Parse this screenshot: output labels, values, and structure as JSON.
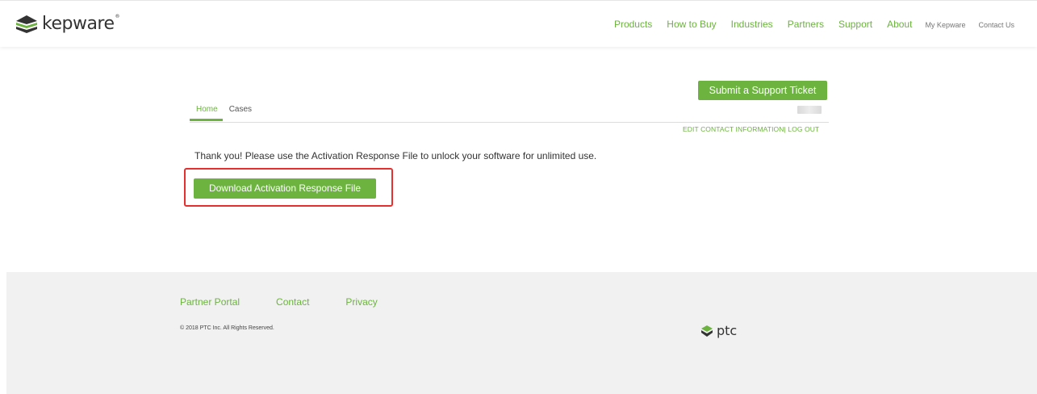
{
  "header": {
    "logo_text": "kepware",
    "logo_reg": "®",
    "nav": [
      {
        "label": "Products"
      },
      {
        "label": "How to Buy"
      },
      {
        "label": "Industries"
      },
      {
        "label": "Partners"
      },
      {
        "label": "Support"
      },
      {
        "label": "About"
      }
    ],
    "nav_small": [
      {
        "label": "My Kepware"
      },
      {
        "label": "Contact Us"
      }
    ]
  },
  "support": {
    "submit_label": "Submit a Support Ticket",
    "tabs": [
      {
        "label": "Home",
        "active": true
      },
      {
        "label": "Cases",
        "active": false
      }
    ],
    "edit_contact_label": "EDIT CONTACT INFORMATION",
    "separator": "|",
    "logout_label": " LOG OUT"
  },
  "main": {
    "message": "Thank you! Please use the Activation Response File to unlock your software for unlimited use.",
    "download_label": "Download Activation Response File"
  },
  "footer": {
    "links": [
      {
        "label": "Partner Portal"
      },
      {
        "label": "Contact"
      },
      {
        "label": "Privacy"
      }
    ],
    "copyright": "© 2018 PTC Inc. All Rights Reserved.",
    "ptc_logo_text": "ptc"
  },
  "colors": {
    "accent": "#6cb33f",
    "highlight": "#e53030",
    "footer_bg": "#f1f1f1"
  }
}
